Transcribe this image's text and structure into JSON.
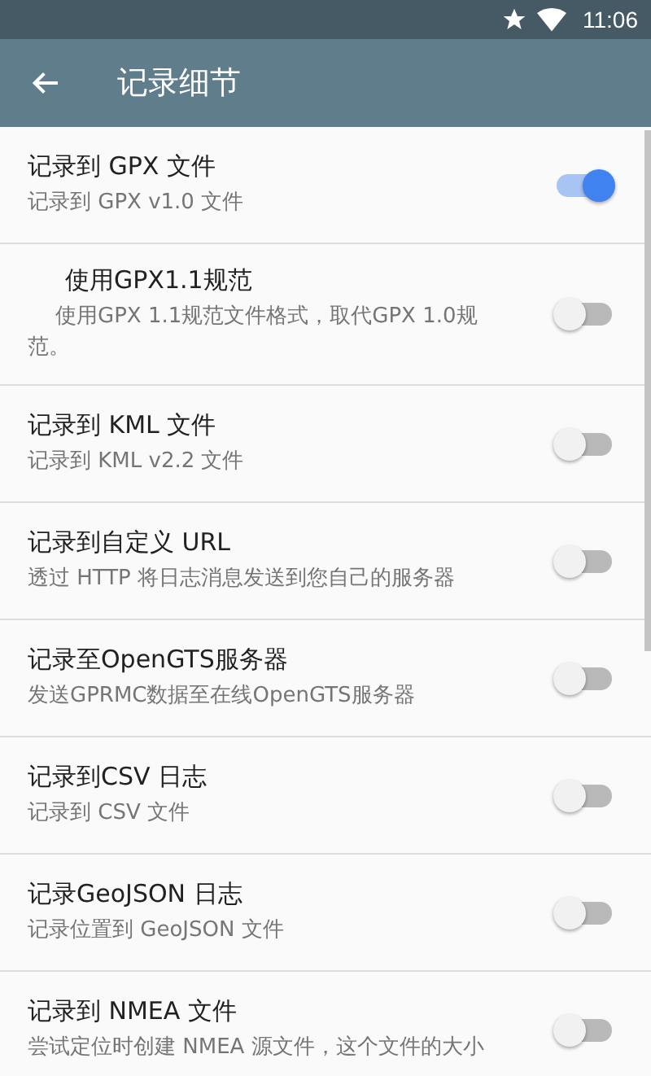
{
  "status_bar": {
    "time": "11:06"
  },
  "toolbar": {
    "title": "记录细节"
  },
  "settings": [
    {
      "title": "记录到 GPX 文件",
      "summary": "记录到 GPX v1.0 文件",
      "on": true,
      "indented": false
    },
    {
      "title": "使用GPX1.1规范",
      "summary": "使用GPX 1.1规范文件格式，取代GPX 1.0规范。",
      "on": false,
      "indented": true
    },
    {
      "title": "记录到 KML 文件",
      "summary": "记录到 KML v2.2 文件",
      "on": false,
      "indented": false
    },
    {
      "title": "记录到自定义 URL",
      "summary": "透过 HTTP 将日志消息发送到您自己的服务器",
      "on": false,
      "indented": false
    },
    {
      "title": "记录至OpenGTS服务器",
      "summary": "发送GPRMC数据至在线OpenGTS服务器",
      "on": false,
      "indented": false
    },
    {
      "title": "记录到CSV 日志",
      "summary": "记录到 CSV 文件",
      "on": false,
      "indented": false
    },
    {
      "title": "记录GeoJSON 日志",
      "summary": "记录位置到 GeoJSON 文件",
      "on": false,
      "indented": false
    },
    {
      "title": "记录到 NMEA 文件",
      "summary": "尝试定位时创建 NMEA 源文件，这个文件的大小",
      "on": false,
      "indented": false
    }
  ]
}
